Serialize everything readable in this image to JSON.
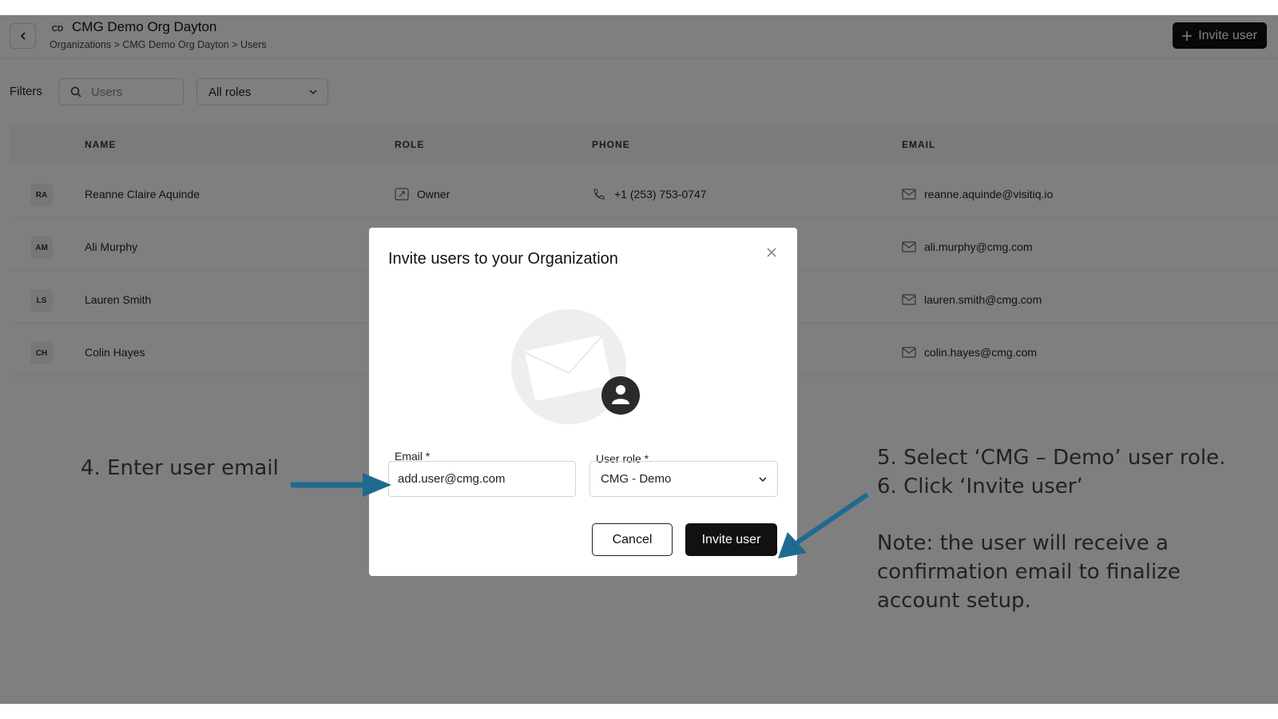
{
  "header": {
    "org_initials": "CD",
    "org_name": "CMG Demo Org Dayton",
    "breadcrumb": "Organizations > CMG Demo Org Dayton > Users",
    "invite_label": "Invite user"
  },
  "filters": {
    "label": "Filters",
    "search_placeholder": "Users",
    "role_value": "All roles"
  },
  "table": {
    "columns": [
      "NAME",
      "ROLE",
      "PHONE",
      "EMAIL"
    ],
    "rows": [
      {
        "initials": "RA",
        "name": "Reanne Claire Aquinde",
        "role": "Owner",
        "phone": "+1 (253) 753-0747",
        "email": "reanne.aquinde@visitiq.io"
      },
      {
        "initials": "AM",
        "name": "Ali Murphy",
        "role": "",
        "phone": "",
        "email": "ali.murphy@cmg.com"
      },
      {
        "initials": "LS",
        "name": "Lauren Smith",
        "role": "",
        "phone": "",
        "email": "lauren.smith@cmg.com"
      },
      {
        "initials": "CH",
        "name": "Colin Hayes",
        "role": "",
        "phone": "",
        "email": "colin.hayes@cmg.com"
      }
    ]
  },
  "modal": {
    "title": "Invite users to your Organization",
    "email_label": "Email *",
    "email_value": "add.user@cmg.com",
    "role_label": "User role *",
    "role_value": "CMG - Demo",
    "cancel_label": "Cancel",
    "invite_label": "Invite user"
  },
  "annotations": {
    "step4": "4. Enter user email",
    "step5": "5. Select ‘CMG – Demo’ user role.",
    "step6": "6. Click ‘Invite user’",
    "note1": "Note: the user will receive a",
    "note2": "confirmation email to finalize",
    "note3": "account setup."
  },
  "colors": {
    "overlay": "#808080",
    "arrow": "#1f6a8f",
    "primary_button": "#111111"
  }
}
